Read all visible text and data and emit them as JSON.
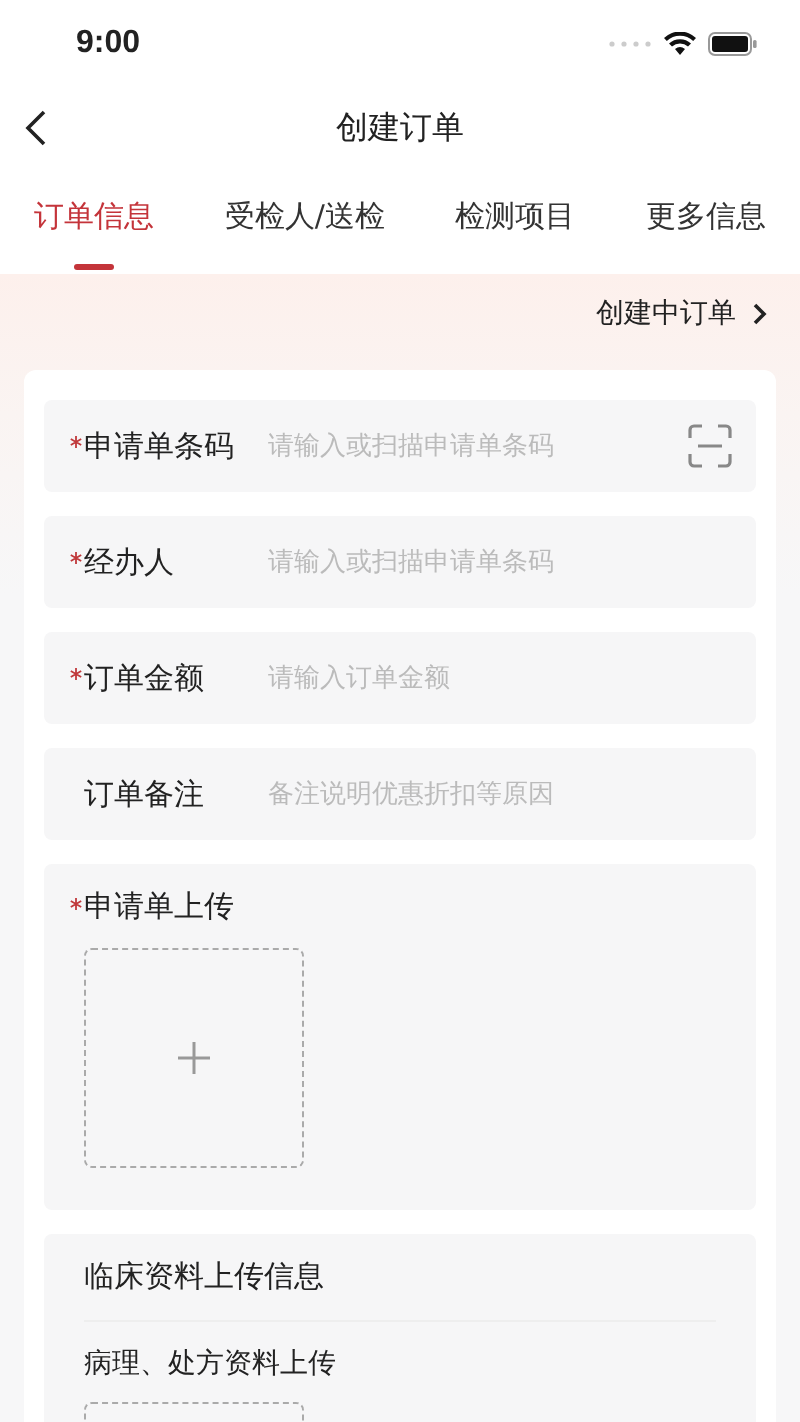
{
  "status_bar": {
    "time": "9:00"
  },
  "nav": {
    "title": "创建订单"
  },
  "tabs": [
    {
      "label": "订单信息",
      "selected": true
    },
    {
      "label": "受检人/送检",
      "selected": false
    },
    {
      "label": "检测项目",
      "selected": false
    },
    {
      "label": "更多信息",
      "selected": false
    }
  ],
  "draft_link": {
    "label": "创建中订单"
  },
  "fields": [
    {
      "kind": "input",
      "label": "申请单条码",
      "required": true,
      "placeholder": "请输入或扫描申请单条码",
      "scan": true
    },
    {
      "kind": "input",
      "label": "经办人",
      "required": true,
      "placeholder": "请输入或扫描申请单条码",
      "scan": false
    },
    {
      "kind": "input",
      "label": "订单金额",
      "required": true,
      "placeholder": "请输入订单金额",
      "scan": false
    },
    {
      "kind": "input",
      "label": "订单备注",
      "required": false,
      "placeholder": "备注说明优惠折扣等原因",
      "scan": false
    },
    {
      "kind": "upload",
      "label": "申请单上传",
      "required": true
    }
  ],
  "clinical": {
    "title": "临床资料上传信息",
    "subtitle": "病理、处方资料上传"
  }
}
